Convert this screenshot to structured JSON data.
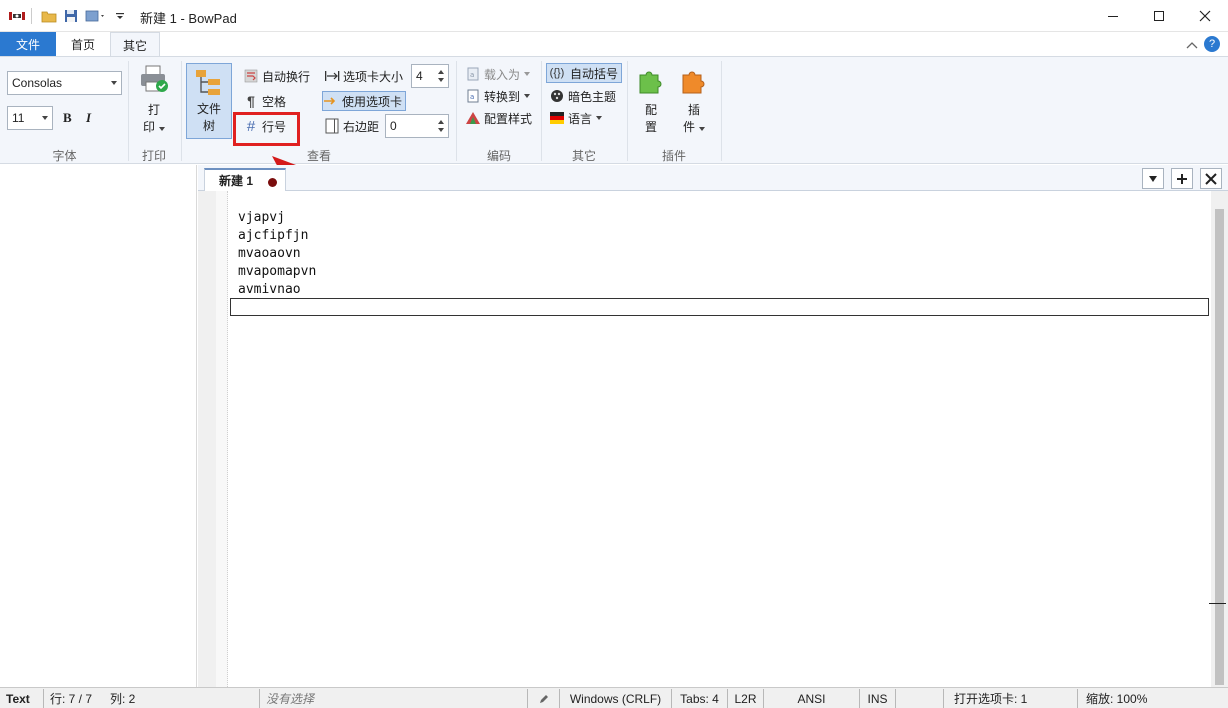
{
  "window": {
    "title": "新建 1 - BowPad",
    "minimize_icon": "minimize-icon",
    "maximize_icon": "maximize-icon",
    "close_icon": "close-icon"
  },
  "ribbon_tabs": {
    "file": "文件",
    "home": "首页",
    "other": "其它"
  },
  "ribbon": {
    "font_group": {
      "font_name": "Consolas",
      "font_size": "11",
      "bold": "B",
      "italic": "I",
      "label": "字体"
    },
    "print_group": {
      "print_line1": "打",
      "print_line2": "印",
      "label": "打印"
    },
    "view_group": {
      "filetree_line1": "文件",
      "filetree_line2": "树",
      "word_wrap": "自动换行",
      "whitespace": "空格",
      "line_numbers": "行号",
      "tab_size_label": "选项卡大小",
      "tab_size_value": "4",
      "use_tabs": "使用选项卡",
      "right_margin_label": "右边距",
      "right_margin_value": "0",
      "label": "查看"
    },
    "encoding_group": {
      "load_as": "载入为",
      "convert_to": "转换到",
      "config_style": "配置样式",
      "label": "编码"
    },
    "other_group": {
      "auto_brace": "自动括号",
      "dark_theme": "暗色主题",
      "language": "语言",
      "label": "其它"
    },
    "plugin_group": {
      "config_line1": "配",
      "config_line2": "置",
      "plugins_line1": "插",
      "plugins_line2": "件",
      "label": "插件"
    }
  },
  "colors": {
    "accent": "#2b79d0",
    "highlight": "#e02020"
  },
  "editor": {
    "tab_name": "新建 1",
    "lines": [
      "vjapvj",
      "ajcfipfjn",
      "mvaoaovn",
      "mvapomapvn",
      "avmivnao"
    ]
  },
  "statusbar": {
    "lexer": "Text",
    "line": "行: 7 / 7",
    "column": "列: 2",
    "selection": "没有选择",
    "eol": "Windows (CRLF)",
    "tabs": "Tabs: 4",
    "direction": "L2R",
    "encoding": "ANSI",
    "mode": "INS",
    "open_tabs": "打开选项卡: 1",
    "zoom": "缩放: 100%"
  }
}
